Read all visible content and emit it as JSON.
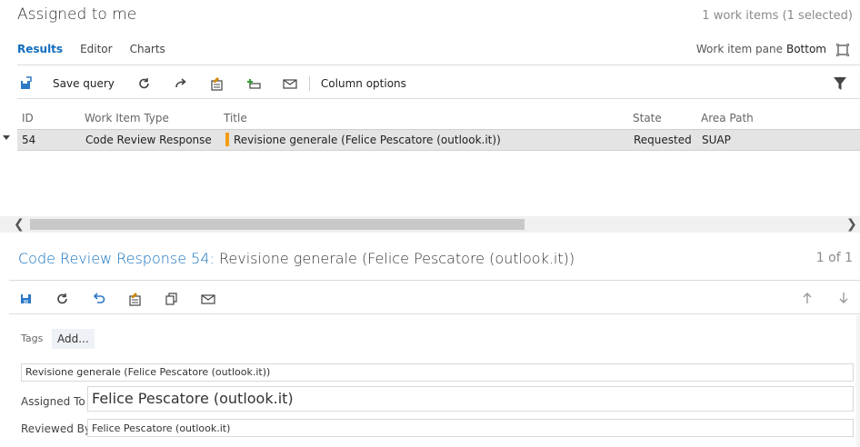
{
  "header": {
    "title": "Assigned to me",
    "count": "1 work items (1 selected)"
  },
  "tabs": [
    {
      "label": "Results",
      "active": true
    },
    {
      "label": "Editor",
      "active": false
    },
    {
      "label": "Charts",
      "active": false
    }
  ],
  "pane": {
    "label": "Work item pane",
    "value": "Bottom"
  },
  "toolbar": {
    "save_query": "Save query",
    "column_options": "Column options"
  },
  "grid": {
    "columns": [
      "ID",
      "Work Item Type",
      "Title",
      "State",
      "Area Path"
    ],
    "rows": [
      {
        "id": "54",
        "type": "Code Review Response",
        "title": "Revisione generale (Felice Pescatore (outlook.it))",
        "state": "Requested",
        "area": "SUAP",
        "color": "#f39c12"
      }
    ]
  },
  "scroll": {
    "left_arrow": "❮",
    "right_arrow": "❯"
  },
  "form": {
    "type_link": "Code Review Response 54:",
    "title": "Revisione generale (Felice Pescatore (outlook.it))",
    "pager": "1 of 1",
    "tags_label": "Tags",
    "add_label": "Add...",
    "title_field": "Revisione generale (Felice Pescatore (outlook.it))",
    "assigned_label": "Assigned To",
    "assigned_value": "Felice Pescatore (outlook.it)",
    "reviewed_label": "Reviewed By",
    "reviewed_value": "Felice Pescatore (outlook.it)"
  },
  "colors": {
    "accent": "#106ebe",
    "selected_row": "#e4e4e4",
    "item_color": "#f39c12"
  }
}
